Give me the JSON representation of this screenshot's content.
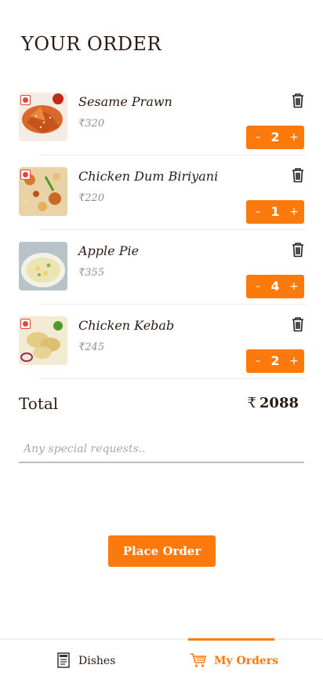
{
  "page": {
    "title": "YOUR ORDER"
  },
  "items": [
    {
      "name": "Sesame Prawn",
      "price": "₹320",
      "quantity": "2",
      "image": "sesame-prawn-photo",
      "veg_marker": true
    },
    {
      "name": "Chicken Dum Biriyani",
      "price": "₹220",
      "quantity": "1",
      "image": "chicken-biriyani-photo",
      "veg_marker": true
    },
    {
      "name": "Apple Pie",
      "price": "₹355",
      "quantity": "4",
      "image": "apple-pie-photo",
      "veg_marker": false
    },
    {
      "name": "Chicken Kebab",
      "price": "₹245",
      "quantity": "2",
      "image": "chicken-kebab-photo",
      "veg_marker": true
    }
  ],
  "stepper": {
    "minus": "–",
    "plus": "+"
  },
  "total": {
    "label": "Total",
    "currency": "₹",
    "amount": "2088"
  },
  "special_requests": {
    "placeholder": "Any special requests..",
    "value": ""
  },
  "actions": {
    "place_order": "Place Order"
  },
  "bottom_nav": {
    "tabs": [
      {
        "label": "Dishes",
        "icon": "menu-card-icon",
        "active": false
      },
      {
        "label": "My Orders",
        "icon": "shopping-cart-icon",
        "active": true
      }
    ]
  },
  "colors": {
    "accent": "#fb7a0b",
    "text": "#2b1a12",
    "muted": "#8e8e8e",
    "veg_marker": "#e8463c"
  }
}
